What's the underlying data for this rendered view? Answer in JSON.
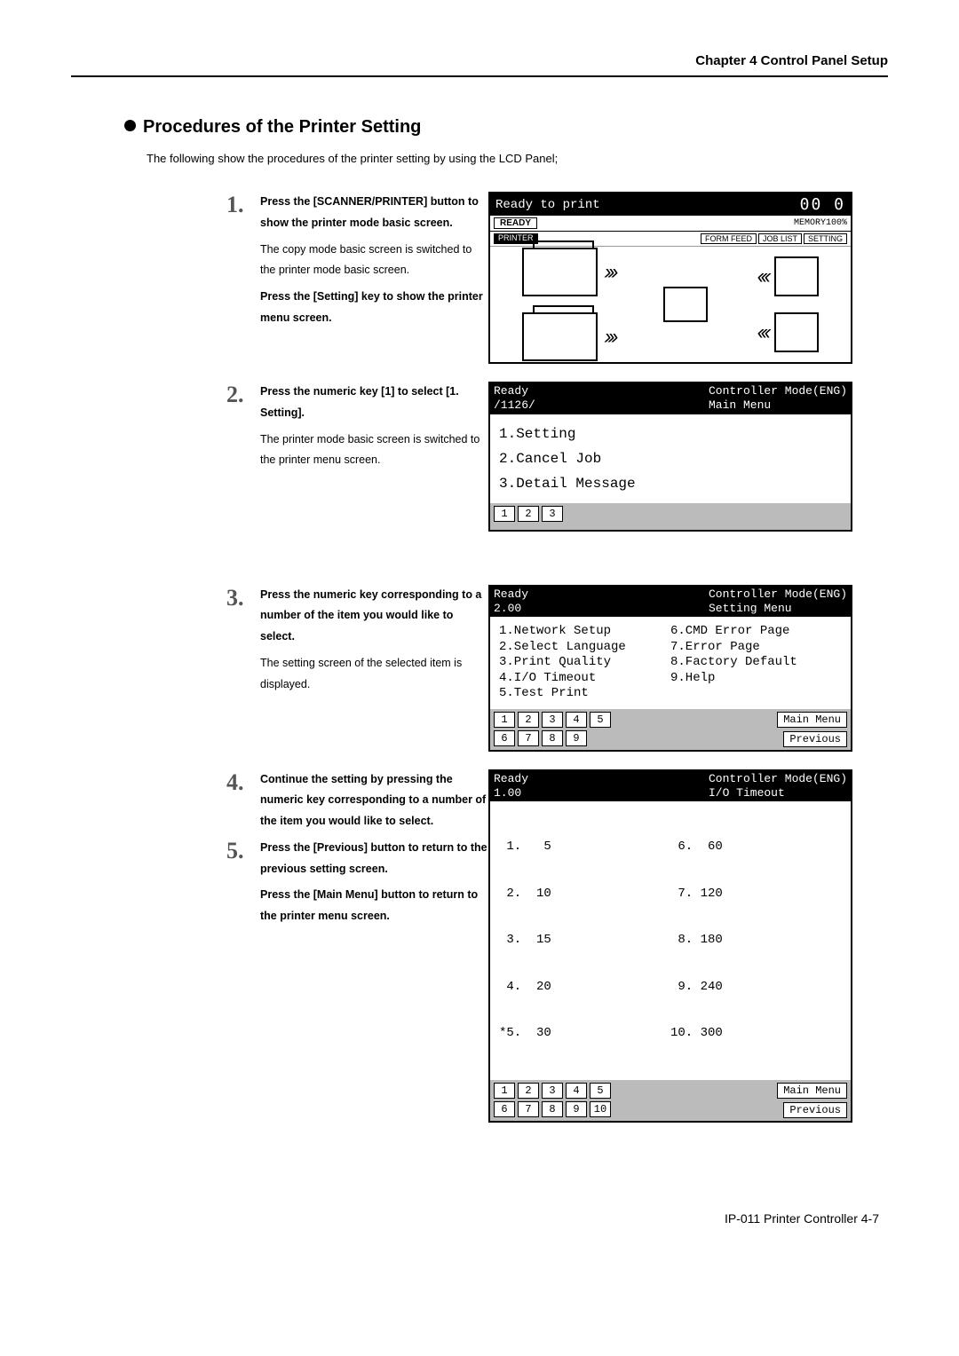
{
  "chapter": "Chapter 4  Control Panel Setup",
  "section_title": "Procedures of the Printer Setting",
  "intro": "The following show the procedures of the printer setting by using the LCD Panel;",
  "steps": {
    "s1": {
      "num": "1.",
      "bold1": "Press the [SCANNER/PRINTER] button to show the printer mode basic screen.",
      "plain1": "The copy mode basic screen is switched to the printer mode basic screen.",
      "bold2": "Press the [Setting] key to show the printer menu screen."
    },
    "s2": {
      "num": "2.",
      "bold1": "Press the numeric key [1] to select [1. Setting].",
      "plain1": "The printer mode basic screen is switched to the printer menu screen."
    },
    "s3": {
      "num": "3.",
      "bold1": "Press the numeric key corresponding to a number of the item you would like to select.",
      "plain1": "The setting screen of the selected item is displayed."
    },
    "s4": {
      "num": "4.",
      "bold1": "Continue the setting by pressing the numeric key corresponding to a number of the item you would like to select."
    },
    "s5": {
      "num": "5.",
      "bold1": "Press the [Previous] button to return to the previous setting screen.",
      "bold2": "Press the [Main Menu] button to return to the printer menu screen."
    }
  },
  "screen1": {
    "title": "Ready to print",
    "counter": "00 0",
    "ready": "READY",
    "memory": "MEMORY100%",
    "printer_label": "PRINTER",
    "btns": {
      "formfeed": "FORM FEED",
      "joblist": "JOB LIST",
      "setting": "SETTING"
    }
  },
  "screen2": {
    "hdr_left1": "Ready",
    "hdr_left2": "/1126/",
    "hdr_right1": "Controller Mode(ENG)",
    "hdr_right2": "Main Menu",
    "items": {
      "i1": "1.Setting",
      "i2": "2.Cancel Job",
      "i3": "3.Detail Message"
    },
    "keys": {
      "k1": "1",
      "k2": "2",
      "k3": "3"
    }
  },
  "screen3": {
    "hdr_left1": "Ready",
    "hdr_left2": "2.00",
    "hdr_right1": "Controller Mode(ENG)",
    "hdr_right2": "Setting Menu",
    "left": {
      "l1": "1.Network Setup",
      "l2": "2.Select Language",
      "l3": "3.Print Quality",
      "l4": "4.I/O Timeout",
      "l5": "5.Test Print"
    },
    "right": {
      "r1": "6.CMD Error Page",
      "r2": "7.Error Page",
      "r3": "8.Factory Default",
      "r4": "9.Help"
    },
    "keys": {
      "k1": "1",
      "k2": "2",
      "k3": "3",
      "k4": "4",
      "k5": "5",
      "k6": "6",
      "k7": "7",
      "k8": "8",
      "k9": "9"
    },
    "btn_main": "Main Menu",
    "btn_prev": "Previous"
  },
  "screen4": {
    "hdr_left1": "Ready",
    "hdr_left2": "1.00",
    "hdr_right1": "Controller Mode(ENG)",
    "hdr_right2": "I/O Timeout",
    "left": {
      "l1": " 1.   5",
      "l2": " 2.  10",
      "l3": " 3.  15",
      "l4": " 4.  20",
      "l5": "*5.  30"
    },
    "right": {
      "r1": " 6.  60",
      "r2": " 7. 120",
      "r3": " 8. 180",
      "r4": " 9. 240",
      "r5": "10. 300"
    },
    "keys": {
      "k1": "1",
      "k2": "2",
      "k3": "3",
      "k4": "4",
      "k5": "5",
      "k6": "6",
      "k7": "7",
      "k8": "8",
      "k9": "9",
      "k10": "10"
    },
    "btn_main": "Main Menu",
    "btn_prev": "Previous"
  },
  "footer": "IP-011 Printer Controller  4-7"
}
